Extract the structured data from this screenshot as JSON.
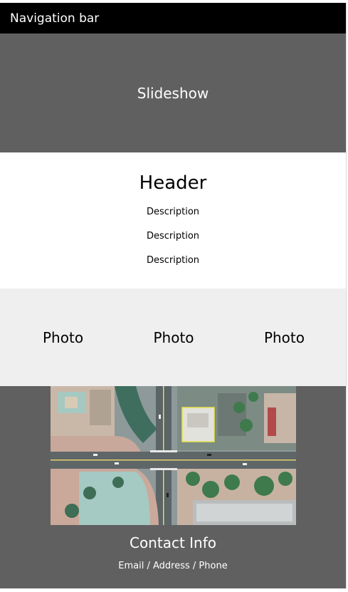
{
  "navbar": {
    "label": "Navigation bar"
  },
  "slideshow": {
    "label": "Slideshow"
  },
  "header": {
    "title": "Header",
    "descriptions": [
      "Description",
      "Description",
      "Description"
    ]
  },
  "photos": [
    "Photo",
    "Photo",
    "Photo"
  ],
  "footer": {
    "contact_title": "Contact Info",
    "contact_line": "Email / Address / Phone"
  },
  "colors": {
    "navbar_bg": "#000000",
    "slideshow_bg": "#606060",
    "photos_bg": "#efefef",
    "footer_bg": "#606060"
  }
}
